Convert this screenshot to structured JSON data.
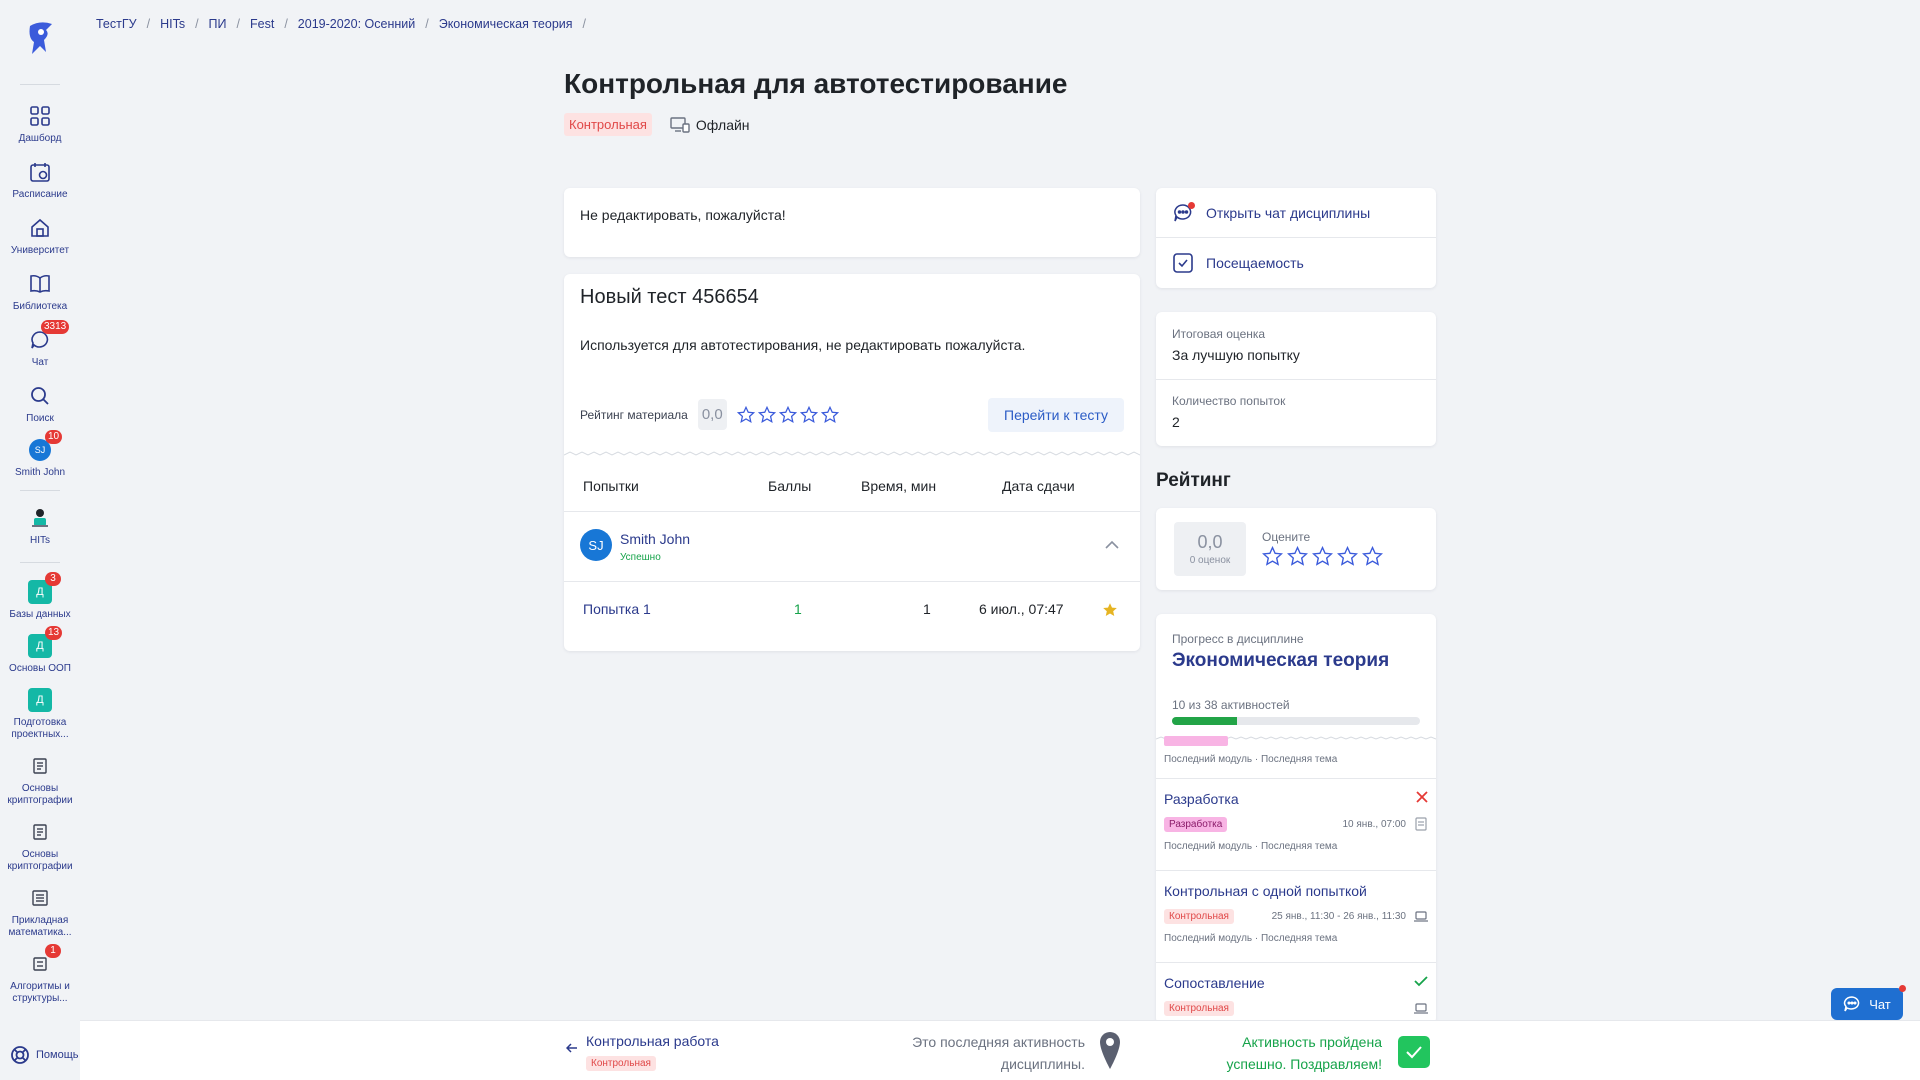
{
  "breadcrumb": [
    "ТестГУ",
    "HITs",
    "ПИ",
    "Fest",
    "2019-2020: Осенний",
    "Экономическая теория"
  ],
  "sidebar": {
    "items": [
      {
        "label": "Дашборд",
        "icon": "dashboard-icon"
      },
      {
        "label": "Расписание",
        "icon": "calendar-icon"
      },
      {
        "label": "Университет",
        "icon": "university-icon"
      },
      {
        "label": "Библиотека",
        "icon": "book-icon"
      },
      {
        "label": "Чат",
        "icon": "chat-icon",
        "badge": "3313"
      },
      {
        "label": "Поиск",
        "icon": "search-icon"
      },
      {
        "label": "Smith John",
        "avatar": "SJ",
        "badge": "10"
      },
      {
        "label": "HITs",
        "icon": "hits-logo-icon"
      },
      {
        "label": "Базы данных",
        "letter": "Д",
        "badge": "3"
      },
      {
        "label": "Основы ООП",
        "letter": "Д",
        "badge": "13"
      },
      {
        "label": "Подготовка проектных...",
        "letter": "Д"
      },
      {
        "label": "Основы криптографии",
        "icon": "course-icon"
      },
      {
        "label": "Основы криптографии",
        "icon": "course-icon"
      },
      {
        "label": "Прикладная математика...",
        "icon": "course-icon"
      },
      {
        "label": "Алгоритмы и структуры...",
        "icon": "course-icon",
        "badge": "1"
      }
    ],
    "help_label": "Помощь"
  },
  "header": {
    "title": "Контрольная для автотестирование",
    "tag": "Контрольная",
    "mode": "Офлайн"
  },
  "note": "Не редактировать, пожалуйста!",
  "test": {
    "title": "Новый тест 456654",
    "description": "Используется для автотестирования, не редактировать пожалуйста.",
    "rating_label": "Рейтинг материала",
    "rating_value": "0,0",
    "go_button": "Перейти к тесту",
    "columns": [
      "Попытки",
      "Баллы",
      "Время, мин",
      "Дата сдачи"
    ],
    "user": {
      "initials": "SJ",
      "name": "Smith John",
      "status": "Успешно"
    },
    "attempts": [
      {
        "name": "Попытка 1",
        "score": "1",
        "time": "1",
        "date": "6 июл., 07:47"
      }
    ]
  },
  "links": {
    "chat": "Открыть чат дисциплины",
    "attendance": "Посещаемость"
  },
  "grade": {
    "final_label": "Итоговая оценка",
    "final_value": "За лучшую попытку",
    "attempts_label": "Количество попыток",
    "attempts_value": "2"
  },
  "rating": {
    "title": "Рейтинг",
    "value": "0,0",
    "count": "0 оценок",
    "rate_label": "Оцените"
  },
  "progress": {
    "label": "Прогресс в дисциплине",
    "course": "Экономическая теория",
    "count": "10 из 38 активностей",
    "fraction": 0.263,
    "meta": "Последний модуль · Последняя тема",
    "activities": [
      {
        "title": "Разработка",
        "tag": "Разработка",
        "tag_type": "pink",
        "date": "10 янв., 07:00",
        "status": "cross"
      },
      {
        "title": "Контрольная с одной попыткой",
        "tag": "Контрольная",
        "tag_type": "red",
        "date": "25 янв., 11:30 - 26 янв., 11:30",
        "status": "none"
      },
      {
        "title": "Сопоставление",
        "tag": "Контрольная",
        "tag_type": "red",
        "date": "",
        "status": "check"
      }
    ]
  },
  "bottom": {
    "prev_title": "Контрольная работа",
    "prev_tag": "Контрольная",
    "last_text": "Это последняя активность дисциплины.",
    "done_text": "Активность пройдена успешно. Поздравляем!"
  },
  "chat_fab": "Чат",
  "colors": {
    "accent": "#2b3a8c",
    "success": "#16a34a",
    "danger": "#e53935",
    "star": "#3b5bdb"
  }
}
